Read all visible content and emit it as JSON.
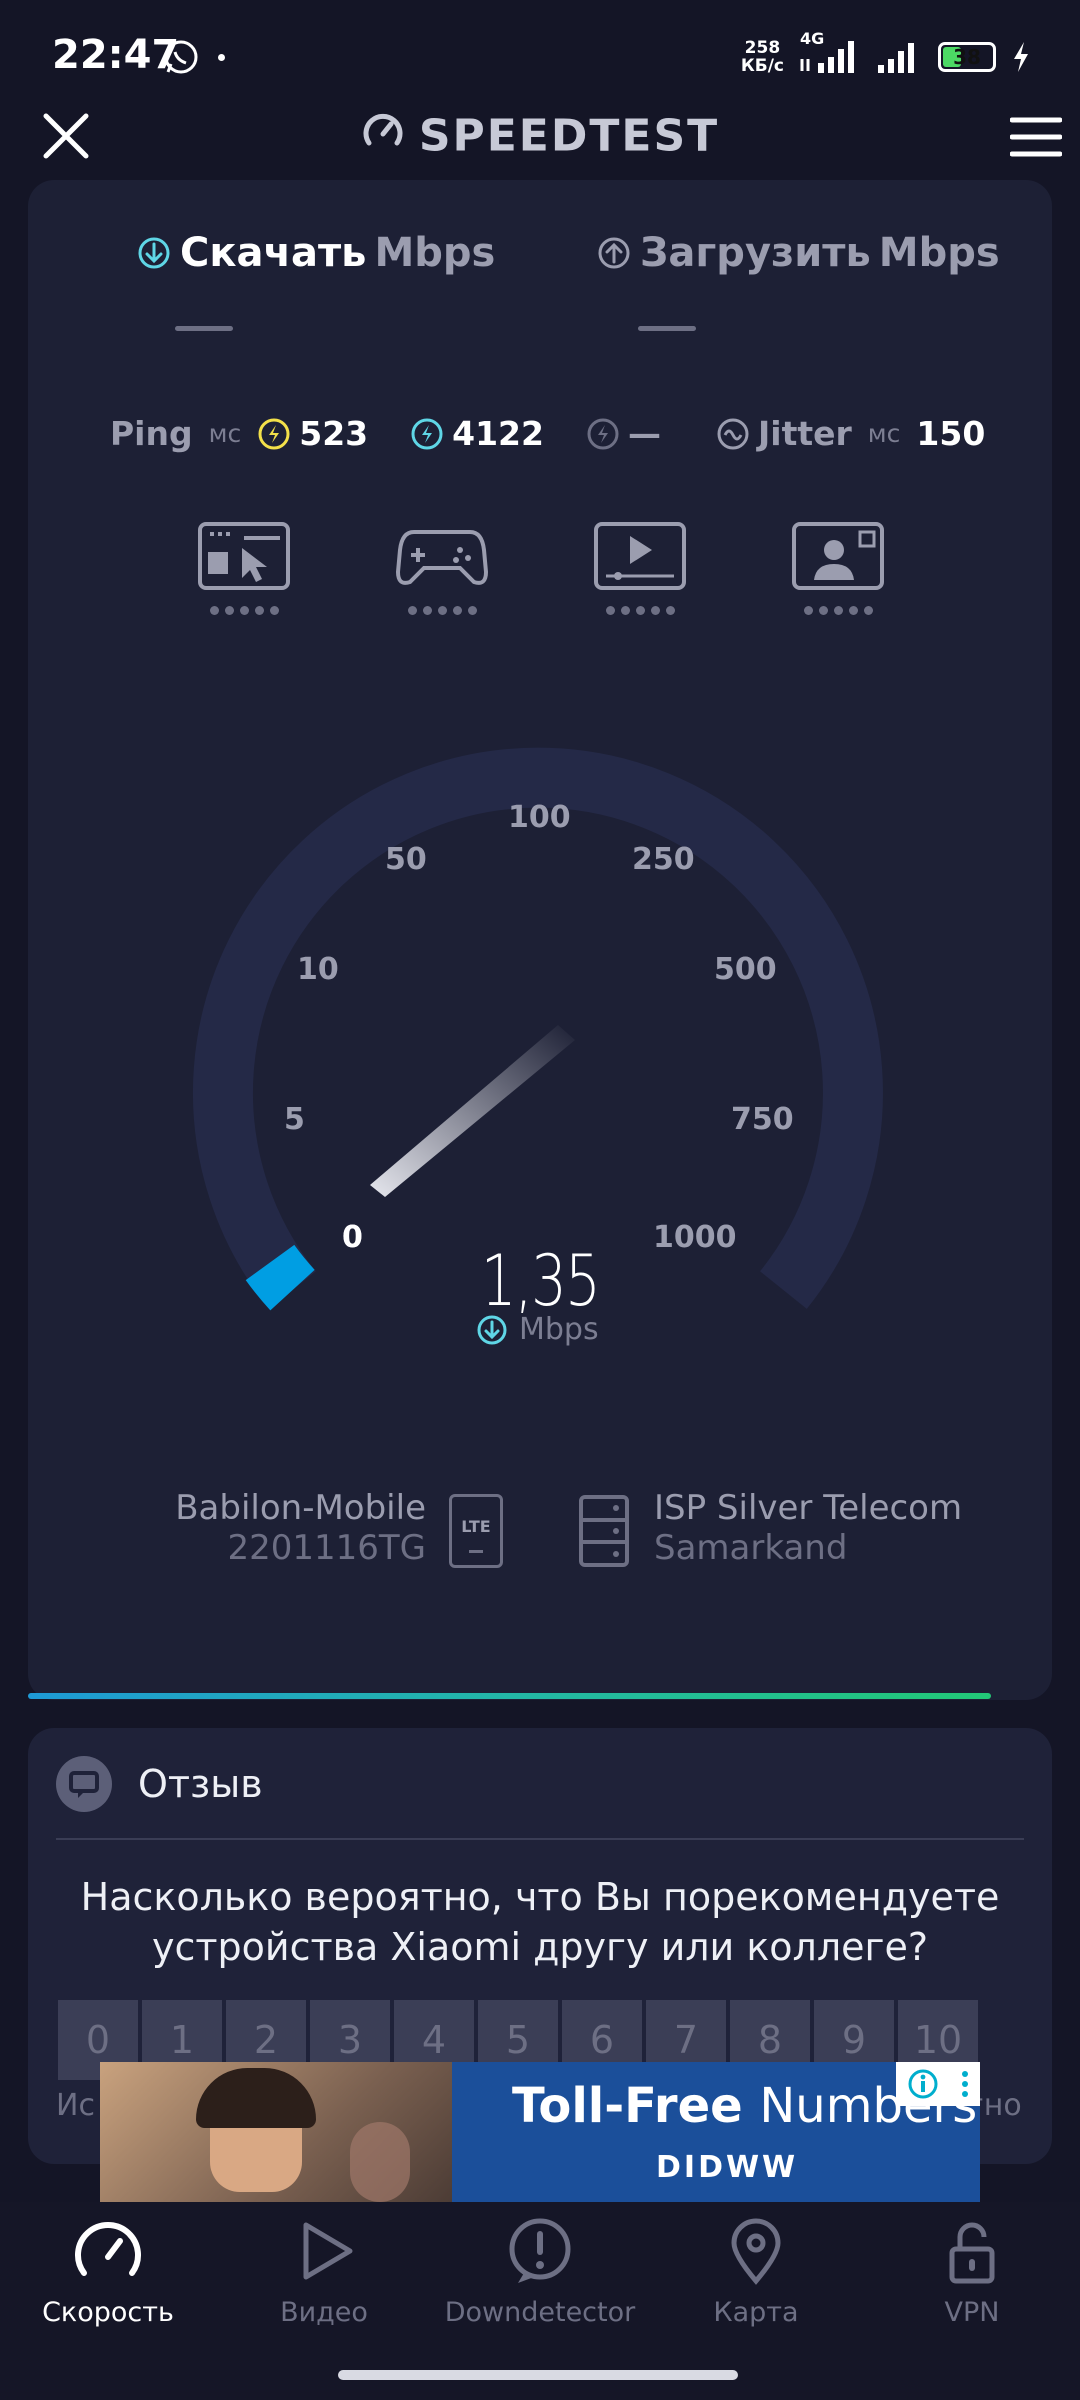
{
  "status_bar": {
    "time": "22:47",
    "net_speed_value": "258",
    "net_speed_unit": "КБ/с",
    "network_type": "4G",
    "battery": "38"
  },
  "header": {
    "title": "SPEEDTEST"
  },
  "tabs": [
    {
      "label": "Скачать",
      "unit": "Mbps",
      "value": "—"
    },
    {
      "label": "Загрузить",
      "unit": "Mbps",
      "value": "—"
    }
  ],
  "metrics": {
    "ping_label": "Ping",
    "ping_unit": "мс",
    "ping_value": "523",
    "ping_download": "4122",
    "ping_upload": "—",
    "jitter_label": "Jitter",
    "jitter_unit": "мс",
    "jitter_value": "150"
  },
  "gauge": {
    "scale": [
      "0",
      "5",
      "10",
      "50",
      "100",
      "250",
      "500",
      "750",
      "1000"
    ],
    "value": "1,35",
    "unit": "Mbps"
  },
  "server": {
    "provider": "Babilon-Mobile",
    "device": "2201116TG",
    "device_icon_text": "LTE",
    "isp": "ISP Silver Telecom",
    "city": "Samarkand"
  },
  "progress_fraction": 0.94,
  "feedback": {
    "title": "Отзыв",
    "question_line1": "Насколько вероятно, что Вы порекомендуете",
    "question_line2": "устройства Xiaomi другу или коллеге?",
    "scale": [
      "0",
      "1",
      "2",
      "3",
      "4",
      "5",
      "6",
      "7",
      "8",
      "9",
      "10"
    ],
    "left_hint": "Ис",
    "right_hint": "гно"
  },
  "ad": {
    "title_bold": "Toll-Free",
    "title_rest": "Numbers",
    "brand": "DIDWW"
  },
  "nav": [
    {
      "label": "Скорость",
      "icon": "speedometer-icon",
      "active": true
    },
    {
      "label": "Видео",
      "icon": "play-icon",
      "active": false
    },
    {
      "label": "Downdetector",
      "icon": "alert-icon",
      "active": false
    },
    {
      "label": "Карта",
      "icon": "map-pin-icon",
      "active": false
    },
    {
      "label": "VPN",
      "icon": "unlock-icon",
      "active": false
    }
  ],
  "colors": {
    "background": "#141526",
    "card": "#1d2035",
    "accent_blue": "#1e9ad6",
    "accent_cyan": "#5fd6e6",
    "accent_yellow": "#f3e04a"
  }
}
